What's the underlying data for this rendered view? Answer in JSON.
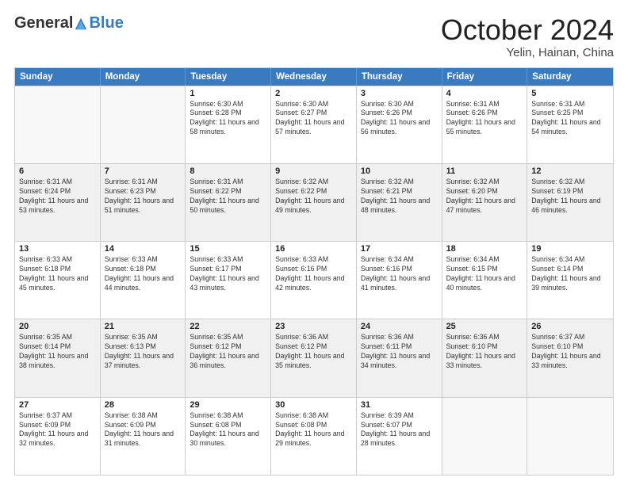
{
  "header": {
    "logo_general": "General",
    "logo_blue": "Blue",
    "month_title": "October 2024",
    "location": "Yelin, Hainan, China"
  },
  "weekdays": [
    "Sunday",
    "Monday",
    "Tuesday",
    "Wednesday",
    "Thursday",
    "Friday",
    "Saturday"
  ],
  "rows": [
    [
      {
        "day": "",
        "info": "",
        "empty": true
      },
      {
        "day": "",
        "info": "",
        "empty": true
      },
      {
        "day": "1",
        "info": "Sunrise: 6:30 AM\nSunset: 6:28 PM\nDaylight: 11 hours and 58 minutes."
      },
      {
        "day": "2",
        "info": "Sunrise: 6:30 AM\nSunset: 6:27 PM\nDaylight: 11 hours and 57 minutes."
      },
      {
        "day": "3",
        "info": "Sunrise: 6:30 AM\nSunset: 6:26 PM\nDaylight: 11 hours and 56 minutes."
      },
      {
        "day": "4",
        "info": "Sunrise: 6:31 AM\nSunset: 6:26 PM\nDaylight: 11 hours and 55 minutes."
      },
      {
        "day": "5",
        "info": "Sunrise: 6:31 AM\nSunset: 6:25 PM\nDaylight: 11 hours and 54 minutes."
      }
    ],
    [
      {
        "day": "6",
        "info": "Sunrise: 6:31 AM\nSunset: 6:24 PM\nDaylight: 11 hours and 53 minutes.",
        "shaded": true
      },
      {
        "day": "7",
        "info": "Sunrise: 6:31 AM\nSunset: 6:23 PM\nDaylight: 11 hours and 51 minutes.",
        "shaded": true
      },
      {
        "day": "8",
        "info": "Sunrise: 6:31 AM\nSunset: 6:22 PM\nDaylight: 11 hours and 50 minutes.",
        "shaded": true
      },
      {
        "day": "9",
        "info": "Sunrise: 6:32 AM\nSunset: 6:22 PM\nDaylight: 11 hours and 49 minutes.",
        "shaded": true
      },
      {
        "day": "10",
        "info": "Sunrise: 6:32 AM\nSunset: 6:21 PM\nDaylight: 11 hours and 48 minutes.",
        "shaded": true
      },
      {
        "day": "11",
        "info": "Sunrise: 6:32 AM\nSunset: 6:20 PM\nDaylight: 11 hours and 47 minutes.",
        "shaded": true
      },
      {
        "day": "12",
        "info": "Sunrise: 6:32 AM\nSunset: 6:19 PM\nDaylight: 11 hours and 46 minutes.",
        "shaded": true
      }
    ],
    [
      {
        "day": "13",
        "info": "Sunrise: 6:33 AM\nSunset: 6:18 PM\nDaylight: 11 hours and 45 minutes."
      },
      {
        "day": "14",
        "info": "Sunrise: 6:33 AM\nSunset: 6:18 PM\nDaylight: 11 hours and 44 minutes."
      },
      {
        "day": "15",
        "info": "Sunrise: 6:33 AM\nSunset: 6:17 PM\nDaylight: 11 hours and 43 minutes."
      },
      {
        "day": "16",
        "info": "Sunrise: 6:33 AM\nSunset: 6:16 PM\nDaylight: 11 hours and 42 minutes."
      },
      {
        "day": "17",
        "info": "Sunrise: 6:34 AM\nSunset: 6:16 PM\nDaylight: 11 hours and 41 minutes."
      },
      {
        "day": "18",
        "info": "Sunrise: 6:34 AM\nSunset: 6:15 PM\nDaylight: 11 hours and 40 minutes."
      },
      {
        "day": "19",
        "info": "Sunrise: 6:34 AM\nSunset: 6:14 PM\nDaylight: 11 hours and 39 minutes."
      }
    ],
    [
      {
        "day": "20",
        "info": "Sunrise: 6:35 AM\nSunset: 6:14 PM\nDaylight: 11 hours and 38 minutes.",
        "shaded": true
      },
      {
        "day": "21",
        "info": "Sunrise: 6:35 AM\nSunset: 6:13 PM\nDaylight: 11 hours and 37 minutes.",
        "shaded": true
      },
      {
        "day": "22",
        "info": "Sunrise: 6:35 AM\nSunset: 6:12 PM\nDaylight: 11 hours and 36 minutes.",
        "shaded": true
      },
      {
        "day": "23",
        "info": "Sunrise: 6:36 AM\nSunset: 6:12 PM\nDaylight: 11 hours and 35 minutes.",
        "shaded": true
      },
      {
        "day": "24",
        "info": "Sunrise: 6:36 AM\nSunset: 6:11 PM\nDaylight: 11 hours and 34 minutes.",
        "shaded": true
      },
      {
        "day": "25",
        "info": "Sunrise: 6:36 AM\nSunset: 6:10 PM\nDaylight: 11 hours and 33 minutes.",
        "shaded": true
      },
      {
        "day": "26",
        "info": "Sunrise: 6:37 AM\nSunset: 6:10 PM\nDaylight: 11 hours and 33 minutes.",
        "shaded": true
      }
    ],
    [
      {
        "day": "27",
        "info": "Sunrise: 6:37 AM\nSunset: 6:09 PM\nDaylight: 11 hours and 32 minutes."
      },
      {
        "day": "28",
        "info": "Sunrise: 6:38 AM\nSunset: 6:09 PM\nDaylight: 11 hours and 31 minutes."
      },
      {
        "day": "29",
        "info": "Sunrise: 6:38 AM\nSunset: 6:08 PM\nDaylight: 11 hours and 30 minutes."
      },
      {
        "day": "30",
        "info": "Sunrise: 6:38 AM\nSunset: 6:08 PM\nDaylight: 11 hours and 29 minutes."
      },
      {
        "day": "31",
        "info": "Sunrise: 6:39 AM\nSunset: 6:07 PM\nDaylight: 11 hours and 28 minutes."
      },
      {
        "day": "",
        "info": "",
        "empty": true
      },
      {
        "day": "",
        "info": "",
        "empty": true
      }
    ]
  ]
}
